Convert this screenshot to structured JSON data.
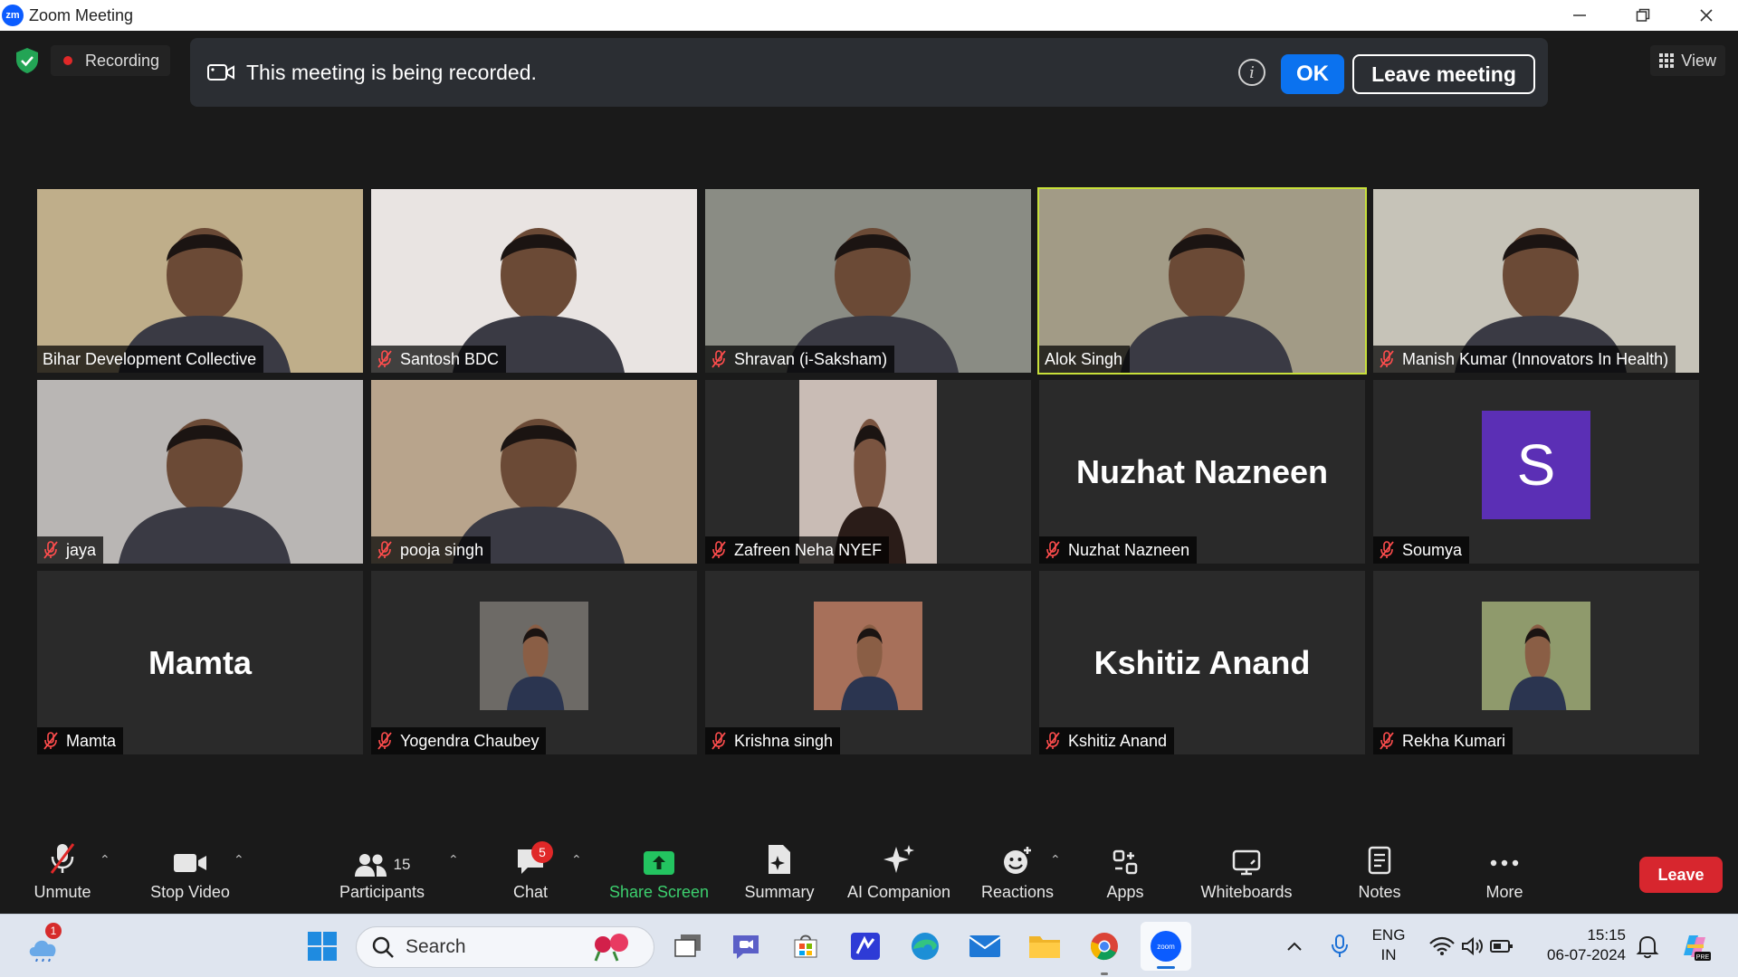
{
  "window": {
    "title": "Zoom Meeting",
    "logo": "zm"
  },
  "top_bar": {
    "recording_label": "Recording",
    "view_label": "View"
  },
  "banner": {
    "message": "This meeting is being recorded.",
    "ok_label": "OK",
    "leave_label": "Leave meeting"
  },
  "participants": [
    {
      "name": "Bihar Development Collective",
      "type": "video",
      "muted": false,
      "speaking": false,
      "bg": "#bfae8a"
    },
    {
      "name": "Santosh BDC",
      "type": "video",
      "muted": true,
      "speaking": false,
      "bg": "#e9e4e2"
    },
    {
      "name": "Shravan (i-Saksham)",
      "type": "video",
      "muted": true,
      "speaking": false,
      "bg": "#8a8c84"
    },
    {
      "name": "Alok Singh",
      "type": "video",
      "muted": false,
      "speaking": true,
      "bg": "#a29b86"
    },
    {
      "name": "Manish Kumar (Innovators In Health)",
      "type": "video",
      "muted": true,
      "speaking": false,
      "bg": "#c6c3b8"
    },
    {
      "name": "jaya",
      "type": "video",
      "muted": true,
      "speaking": false,
      "bg": "#b9b6b4"
    },
    {
      "name": "pooja singh",
      "type": "video",
      "muted": true,
      "speaking": false,
      "bg": "#b8a48c"
    },
    {
      "name": "Zafreen Neha NYEF",
      "type": "video-narrow",
      "muted": true,
      "speaking": false,
      "bg": "#c9bcb5"
    },
    {
      "name": "Nuzhat Nazneen",
      "type": "name",
      "display": "Nuzhat Nazneen",
      "muted": true,
      "speaking": false
    },
    {
      "name": "Soumya",
      "type": "letter",
      "display": "S",
      "muted": true,
      "speaking": false
    },
    {
      "name": "Mamta",
      "type": "name",
      "display": "Mamta",
      "muted": true,
      "speaking": false
    },
    {
      "name": "Yogendra Chaubey",
      "type": "photo",
      "muted": true,
      "speaking": false,
      "bg": "#6d6a66"
    },
    {
      "name": "Krishna singh",
      "type": "photo",
      "muted": true,
      "speaking": false,
      "bg": "#a7705a"
    },
    {
      "name": "Kshitiz Anand",
      "type": "name",
      "display": "Kshitiz Anand",
      "muted": true,
      "speaking": false
    },
    {
      "name": "Rekha Kumari",
      "type": "photo",
      "muted": true,
      "speaking": false,
      "bg": "#8f9a6c"
    }
  ],
  "toolbar": {
    "unmute": "Unmute",
    "stop_video": "Stop Video",
    "participants": "Participants",
    "participants_count": "15",
    "chat": "Chat",
    "chat_badge": "5",
    "share_screen": "Share Screen",
    "summary": "Summary",
    "ai_companion": "AI Companion",
    "reactions": "Reactions",
    "apps": "Apps",
    "whiteboards": "Whiteboards",
    "notes": "Notes",
    "more": "More",
    "leave": "Leave"
  },
  "taskbar": {
    "weather_badge": "1",
    "search_placeholder": "Search",
    "lang_line1": "ENG",
    "lang_line2": "IN",
    "time": "15:15",
    "date": "06-07-2024"
  },
  "colors": {
    "accent_blue": "#0b72ef",
    "leave_red": "#d7262e",
    "share_green": "#3ccf6e",
    "speaker_outline": "#c8e03a",
    "avatar_purple": "#5b2fb5"
  }
}
